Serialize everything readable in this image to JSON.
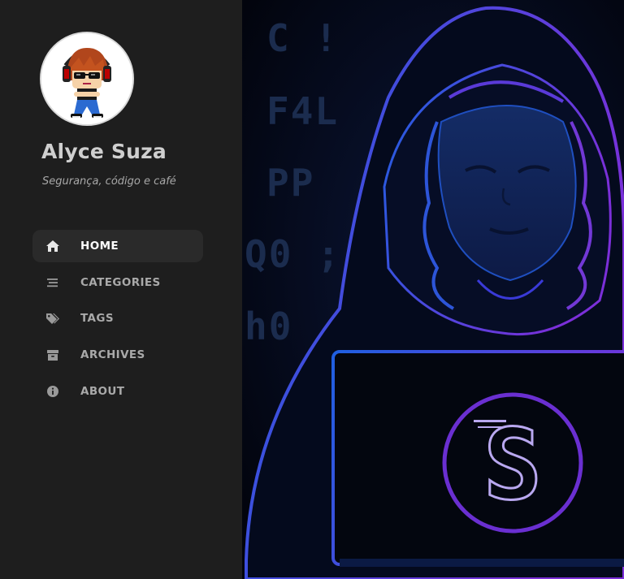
{
  "site": {
    "title": "Alyce Suza",
    "subtitle": "Segurança, código e café"
  },
  "nav": {
    "items": [
      {
        "label": "HOME",
        "icon": "home-icon",
        "active": true
      },
      {
        "label": "CATEGORIES",
        "icon": "stream-icon",
        "active": false
      },
      {
        "label": "TAGS",
        "icon": "tags-icon",
        "active": false
      },
      {
        "label": "ARCHIVES",
        "icon": "archive-icon",
        "active": false
      },
      {
        "label": "ABOUT",
        "icon": "info-circle-icon",
        "active": false
      }
    ]
  },
  "hero": {
    "code_lines": [
      "C !",
      "F4L",
      "PP",
      "Q0 ;",
      "h0"
    ],
    "logo_letter": "S"
  },
  "colors": {
    "sidebar_bg": "#1e1e1e",
    "active_item_bg": "#2a2a2a",
    "hero_bg": "#030612",
    "hood_blue": "#1f5fe0",
    "hood_purple": "#7b2fd9",
    "text_muted": "#a9a9a9"
  }
}
